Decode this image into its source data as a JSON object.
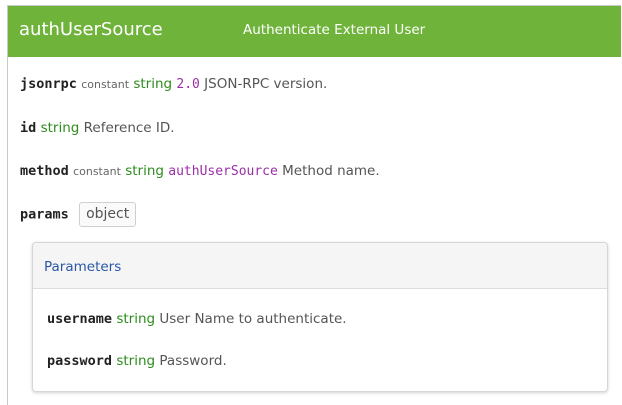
{
  "header": {
    "method_name": "authUserSource",
    "method_description": "Authenticate External User",
    "background_color": "#6fb33b"
  },
  "fields": [
    {
      "name": "jsonrpc",
      "qualifier": "constant",
      "type": "string",
      "value": "2.0",
      "description": "JSON-RPC version."
    },
    {
      "name": "id",
      "type": "string",
      "description": "Reference ID."
    },
    {
      "name": "method",
      "qualifier": "constant",
      "type": "string",
      "value": "authUserSource",
      "description": "Method name."
    },
    {
      "name": "params",
      "type": "object"
    }
  ],
  "params_panel": {
    "title": "Parameters",
    "fields": [
      {
        "name": "username",
        "type": "string",
        "description": "User Name to authenticate."
      },
      {
        "name": "password",
        "type": "string",
        "description": "Password."
      }
    ]
  },
  "colors": {
    "type": "#2e8b1e",
    "value": "#9a2fa8",
    "panel_title": "#2a56a6"
  }
}
